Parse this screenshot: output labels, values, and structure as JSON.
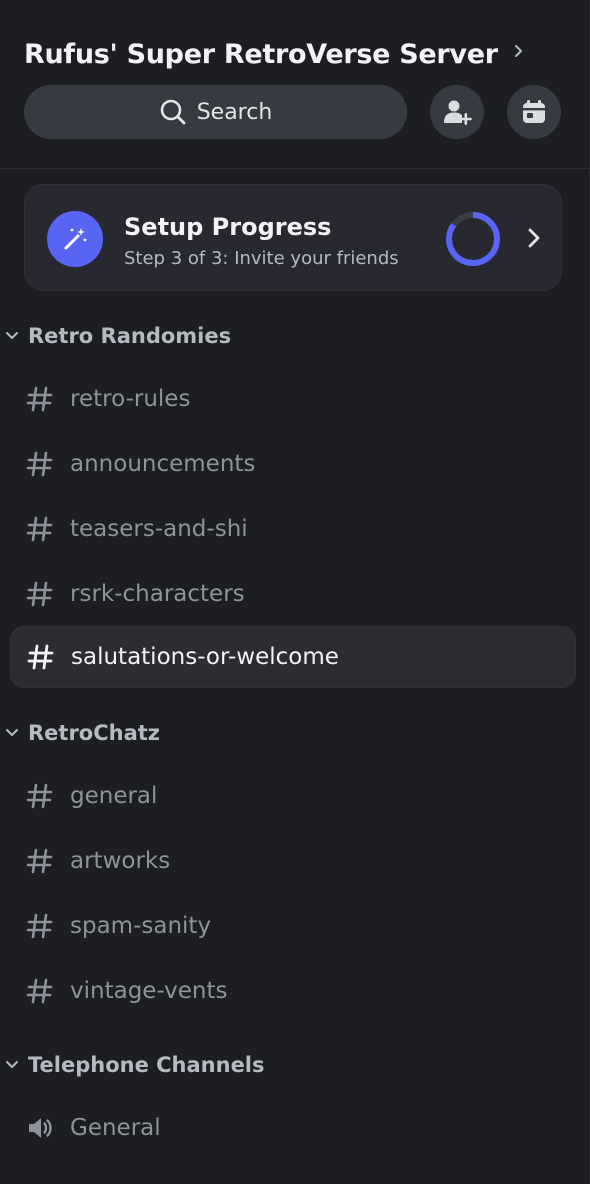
{
  "server": {
    "name": "Rufus' Super RetroVerse Server"
  },
  "toolbar": {
    "search_label": "Search",
    "icons": [
      "search-icon",
      "add-member-icon",
      "calendar-icon"
    ]
  },
  "setup": {
    "title": "Setup Progress",
    "subtitle": "Step 3 of 3: Invite your friends",
    "progress_fraction": 0.85,
    "accent": "#5865f2"
  },
  "categories": [
    {
      "name": "Retro Randomies",
      "channels": [
        {
          "label": "retro-rules",
          "type": "text"
        },
        {
          "label": "announcements",
          "type": "text"
        },
        {
          "label": "teasers-and-shi",
          "type": "text"
        },
        {
          "label": "rsrk-characters",
          "type": "text"
        },
        {
          "label": "salutations-or-welcome",
          "type": "text",
          "active": true
        }
      ]
    },
    {
      "name": "RetroChatz",
      "channels": [
        {
          "label": "general",
          "type": "text"
        },
        {
          "label": "artworks",
          "type": "text"
        },
        {
          "label": "spam-sanity",
          "type": "text"
        },
        {
          "label": "vintage-vents",
          "type": "text"
        }
      ]
    },
    {
      "name": "Telephone Channels",
      "channels": [
        {
          "label": "General",
          "type": "voice"
        }
      ]
    }
  ],
  "colors": {
    "background": "#1d1e23",
    "card": "#272830",
    "pill": "#383a42",
    "muted_text": "#8e9299",
    "active_text": "#f2f3f5"
  }
}
